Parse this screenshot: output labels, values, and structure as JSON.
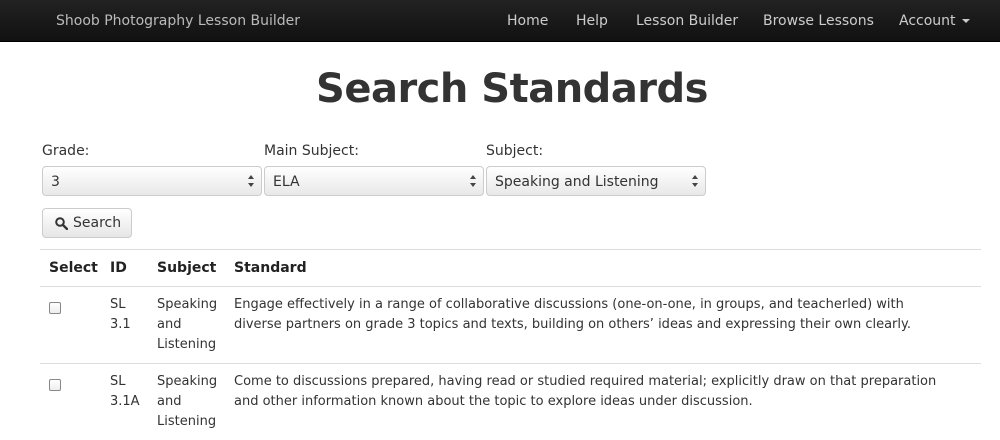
{
  "navbar": {
    "brand": "Shoob Photography Lesson Builder",
    "items": [
      "Home",
      "Help",
      "Lesson Builder",
      "Browse Lessons",
      "Account"
    ]
  },
  "page_title": "Search Standards",
  "filters": {
    "grade": {
      "label": "Grade:",
      "value": "3"
    },
    "main_subject": {
      "label": "Main Subject:",
      "value": "ELA"
    },
    "subject": {
      "label": "Subject:",
      "value": "Speaking and Listening"
    }
  },
  "search_button": {
    "label": "Search",
    "icon": "search-icon"
  },
  "table": {
    "headers": [
      "Select",
      "ID",
      "Subject",
      "Standard"
    ],
    "rows": [
      {
        "id_lines": [
          "SL",
          "3.1"
        ],
        "subject_lines": [
          "Speaking",
          "and",
          "Listening"
        ],
        "standard_lines": [
          "Engage effectively in a range of collaborative discussions (one-on-one, in groups, and teacherled) with",
          "diverse partners on grade 3 topics and texts, building on others’ ideas and expressing their own clearly."
        ],
        "checked": false
      },
      {
        "id_lines": [
          "SL",
          "3.1A"
        ],
        "subject_lines": [
          "Speaking",
          "and",
          "Listening"
        ],
        "standard_lines": [
          "Come to discussions prepared, having read or studied required material; explicitly draw on that preparation",
          "and other information known about the topic to explore ideas under discussion."
        ],
        "checked": false
      }
    ]
  }
}
